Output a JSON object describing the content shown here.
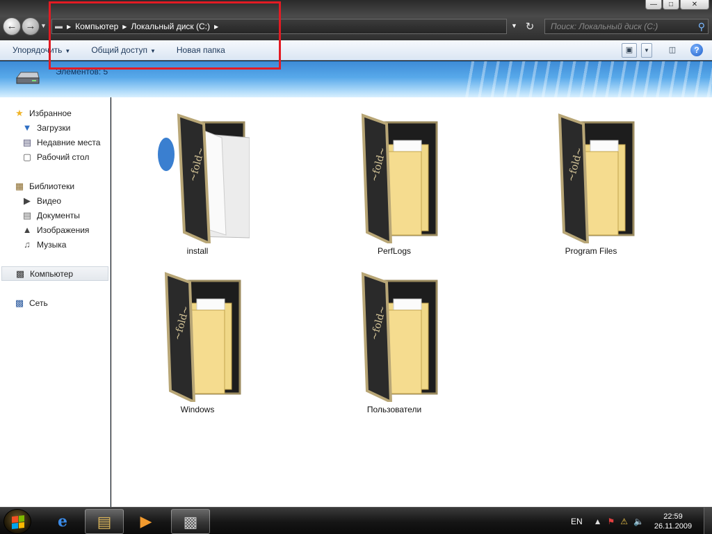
{
  "window": {
    "minimize_glyph": "—",
    "maximize_glyph": "□",
    "close_glyph": "✕"
  },
  "address": {
    "crumbs": [
      "Компьютер",
      "Локальный диск (C:)"
    ],
    "search_placeholder": "Поиск: Локальный диск (C:)"
  },
  "toolbar": {
    "organize": "Упорядочить",
    "share": "Общий доступ",
    "new_folder": "Новая папка"
  },
  "details": {
    "items_count": "Элементов: 5"
  },
  "navpane": {
    "favorites": "Избранное",
    "downloads": "Загрузки",
    "recent": "Недавние места",
    "desktop": "Рабочий стол",
    "libraries": "Библиотеки",
    "video": "Видео",
    "documents": "Документы",
    "pictures": "Изображения",
    "music": "Музыка",
    "computer": "Компьютер",
    "network": "Сеть"
  },
  "files": [
    {
      "name": "install"
    },
    {
      "name": "PerfLogs"
    },
    {
      "name": "Program Files"
    },
    {
      "name": "Windows"
    },
    {
      "name": "Пользователи"
    }
  ],
  "taskbar": {
    "lang": "EN",
    "time": "22:59",
    "date": "26.11.2009"
  }
}
